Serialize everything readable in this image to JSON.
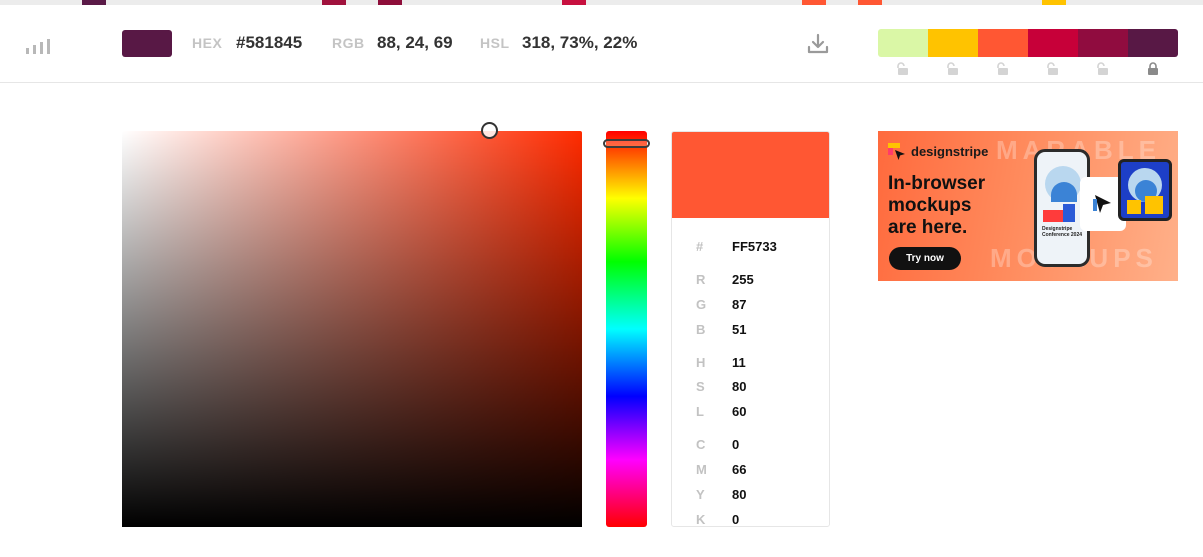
{
  "top_strip_colors": [
    "#5a1a47",
    "#a0123d",
    "#8e0e3a",
    "#c7103f",
    "#ff5733",
    "#ff5733",
    "#ffc300"
  ],
  "header": {
    "current_color": "#581845",
    "hex_label": "HEX",
    "hex_value": "#581845",
    "rgb_label": "RGB",
    "rgb_value": "88, 24, 69",
    "hsl_label": "HSL",
    "hsl_value": "318, 73%, 22%"
  },
  "palette": [
    {
      "color": "#daf7a6",
      "locked": false
    },
    {
      "color": "#ffc300",
      "locked": false
    },
    {
      "color": "#ff5733",
      "locked": false
    },
    {
      "color": "#c70039",
      "locked": false
    },
    {
      "color": "#900c3f",
      "locked": false
    },
    {
      "color": "#581845",
      "locked": true
    }
  ],
  "picker": {
    "hue_color": "#ff2b00",
    "preview_color": "#ff5733",
    "rows": [
      {
        "key": "#",
        "value": "FF5733"
      },
      {
        "key": "R",
        "value": "255"
      },
      {
        "key": "G",
        "value": "87"
      },
      {
        "key": "B",
        "value": "51"
      },
      {
        "key": "H",
        "value": "11"
      },
      {
        "key": "S",
        "value": "80"
      },
      {
        "key": "L",
        "value": "60"
      },
      {
        "key": "C",
        "value": "0"
      },
      {
        "key": "M",
        "value": "66"
      },
      {
        "key": "Y",
        "value": "80"
      },
      {
        "key": "K",
        "value": "0"
      }
    ]
  },
  "ad": {
    "brand": "designstripe",
    "headline_1": "In-browser",
    "headline_2": "mockups",
    "headline_3": "are here.",
    "cta": "Try now",
    "phone_caption": "Designstripe Conference 2024",
    "ghost_1": "MARABLE",
    "ghost_2": "MOCKUPS"
  }
}
